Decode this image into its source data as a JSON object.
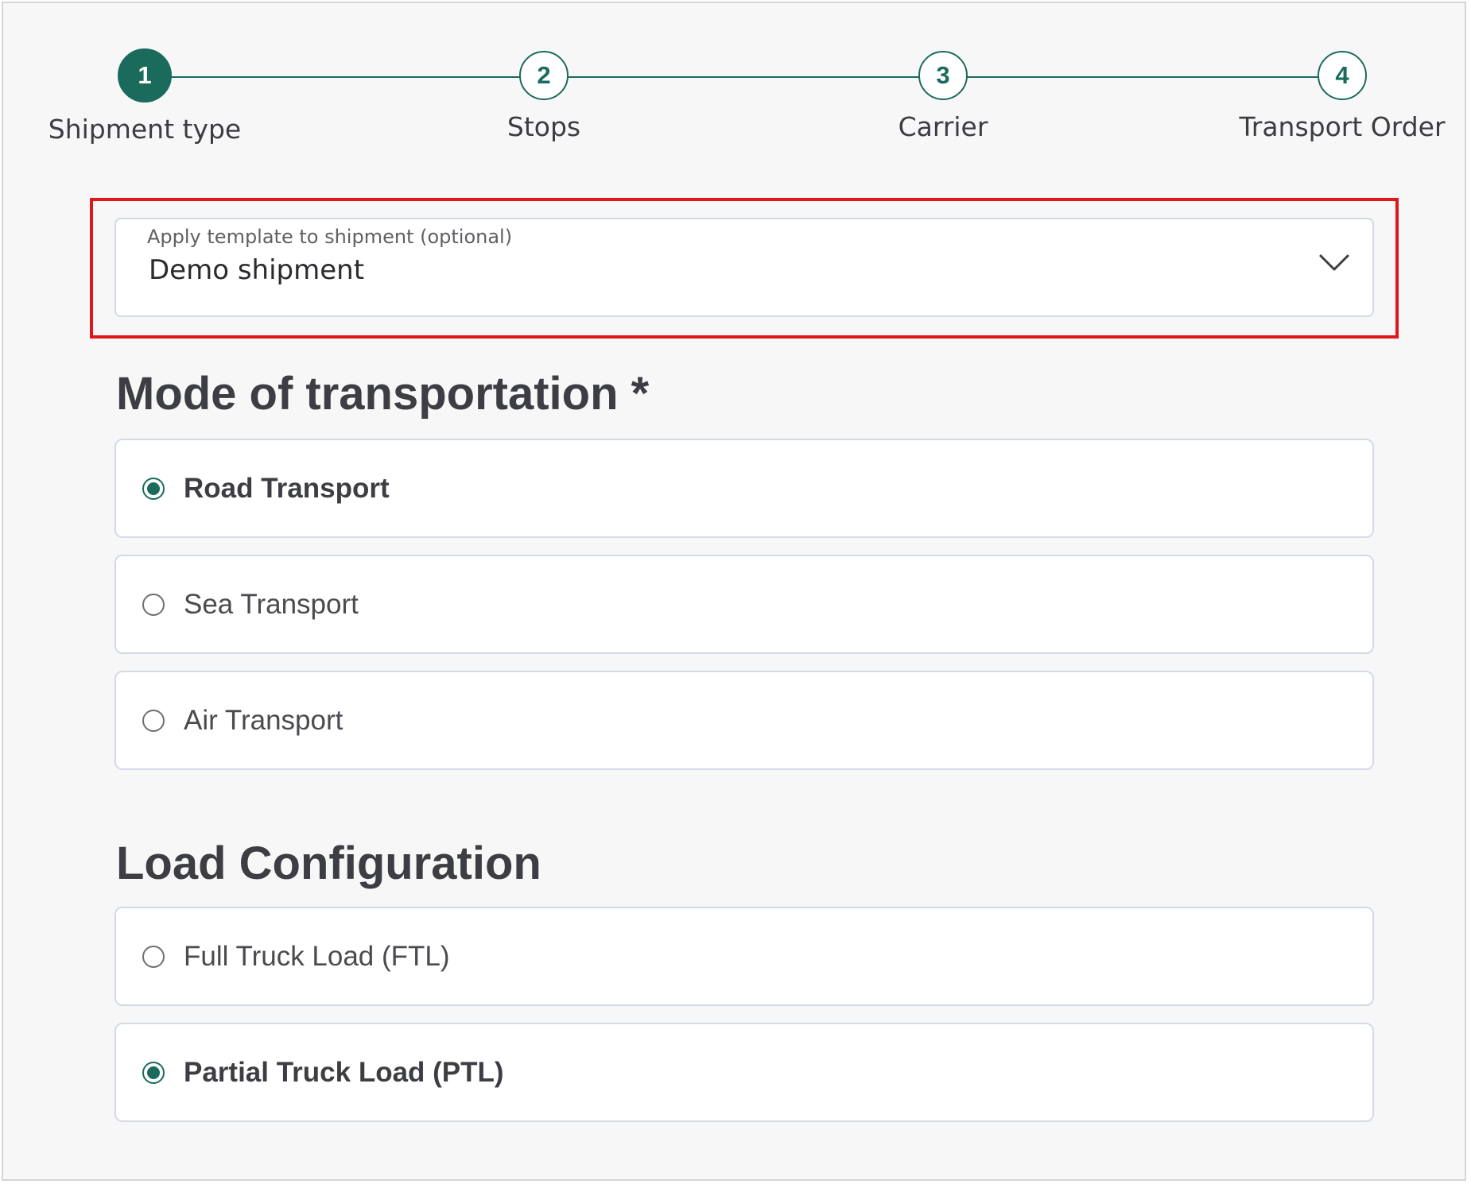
{
  "stepper": {
    "steps": [
      {
        "number": "1",
        "label": "Shipment type",
        "state": "active"
      },
      {
        "number": "2",
        "label": "Stops",
        "state": "upcoming"
      },
      {
        "number": "3",
        "label": "Carrier",
        "state": "upcoming"
      },
      {
        "number": "4",
        "label": "Transport Order",
        "state": "upcoming"
      }
    ]
  },
  "template_select": {
    "label": "Apply template to shipment (optional)",
    "value": "Demo shipment",
    "icon": "chevron-down-icon"
  },
  "mode_section": {
    "title": "Mode of transportation *",
    "options": [
      {
        "label": "Road Transport",
        "selected": true
      },
      {
        "label": "Sea Transport",
        "selected": false
      },
      {
        "label": "Air Transport",
        "selected": false
      }
    ]
  },
  "load_section": {
    "title": "Load Configuration",
    "options": [
      {
        "label": "Full Truck Load (FTL)",
        "selected": false
      },
      {
        "label": "Partial Truck Load (PTL)",
        "selected": true
      }
    ]
  },
  "colors": {
    "accent": "#1a6b5c",
    "highlight": "#e0161b",
    "background": "#f7f7f7",
    "card_border": "#d2dae6"
  }
}
